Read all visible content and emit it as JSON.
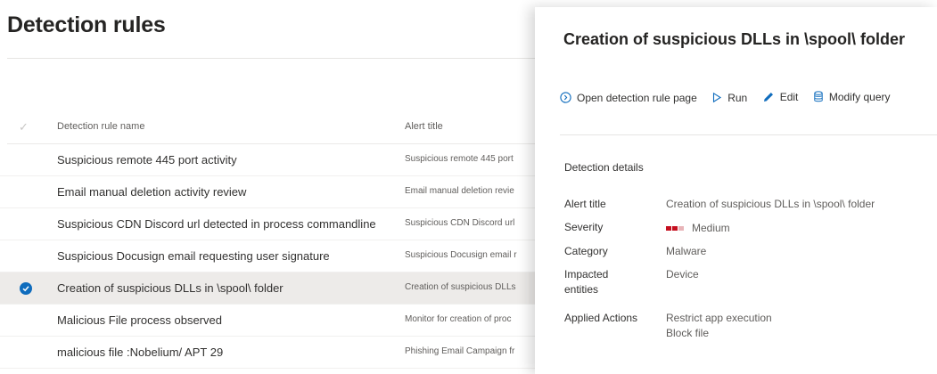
{
  "page": {
    "title": "Detection rules"
  },
  "list": {
    "headers": {
      "name": "Detection rule name",
      "alert": "Alert title"
    },
    "rows": [
      {
        "name": "Suspicious remote 445 port activity",
        "alert": "Suspicious remote 445 port",
        "selected": false
      },
      {
        "name": "Email manual deletion activity review",
        "alert": "Email manual deletion revie",
        "selected": false
      },
      {
        "name": "Suspicious CDN Discord url detected in process commandline",
        "alert": "Suspicious CDN Discord url",
        "selected": false
      },
      {
        "name": "Suspicious Docusign email requesting user signature",
        "alert": "Suspicious Docusign email r",
        "selected": false
      },
      {
        "name": "Creation of suspicious DLLs in \\spool\\ folder",
        "alert": "Creation of suspicious DLLs",
        "selected": true
      },
      {
        "name": "Malicious File process observed",
        "alert": "Monitor for creation of proc",
        "selected": false
      },
      {
        "name": "malicious file :Nobelium/ APT 29",
        "alert": "Phishing Email Campaign fr",
        "selected": false
      }
    ]
  },
  "panel": {
    "title": "Creation of suspicious DLLs in \\spool\\ folder",
    "actions": {
      "open": "Open detection rule page",
      "run": "Run",
      "edit": "Edit",
      "modify": "Modify query"
    },
    "section_title": "Detection details",
    "details": {
      "alert_title": {
        "label": "Alert title",
        "value": "Creation of suspicious DLLs in \\spool\\ folder"
      },
      "severity": {
        "label": "Severity",
        "value": "Medium"
      },
      "category": {
        "label": "Category",
        "value": "Malware"
      },
      "impacted": {
        "label": "Impacted entities",
        "value": "Device"
      },
      "applied": {
        "label": "Applied Actions",
        "values": [
          "Restrict app execution",
          "Block file"
        ]
      }
    }
  },
  "colors": {
    "accent": "#0f6cbd",
    "severity_on": "#c50f1f",
    "severity_off": "#e8b4b8",
    "selected_row": "#edebe9"
  },
  "icons": {
    "open": "chevron-circle-icon",
    "run": "play-icon",
    "edit": "pencil-icon",
    "modify": "database-query-icon",
    "select": "checkmark-circle-icon"
  }
}
